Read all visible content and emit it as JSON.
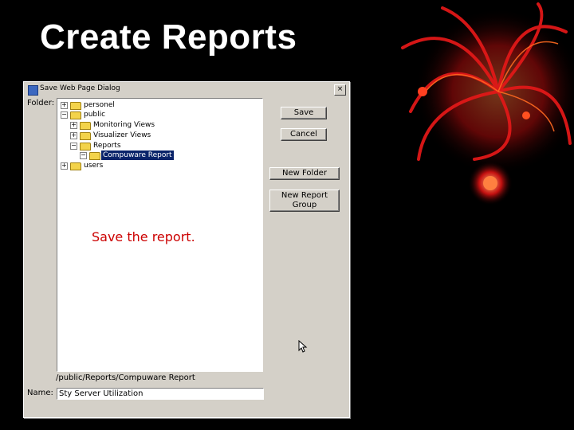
{
  "slide": {
    "title": "Create Reports"
  },
  "dialog": {
    "title": "Save    Web Page Dialog",
    "close_glyph": "×",
    "folder_label": "Folder:",
    "name_label": "Name:",
    "tree": [
      {
        "label": "personel",
        "expander": "+"
      },
      {
        "label": "public",
        "expander": "−"
      },
      {
        "label": "Monitoring Views",
        "expander": "+"
      },
      {
        "label": "Visualizer Views",
        "expander": "+"
      },
      {
        "label": "Reports",
        "expander": "−"
      },
      {
        "label": "Compuware Report",
        "expander": "−"
      },
      {
        "label": "users",
        "expander": "+"
      }
    ],
    "buttons": {
      "save": "Save",
      "cancel": "Cancel",
      "new_folder": "New Folder",
      "new_report_group": "New Report Group"
    },
    "path": "/public/Reports/Compuware Report",
    "name_value": "Sty Server Utilization"
  },
  "annotation": "Save the report.",
  "icons": [
    "folder-icon",
    "expander-icon",
    "mouse-cursor-icon",
    "dialog-app-icon",
    "close-icon"
  ],
  "colors": {
    "selection": "#0a246a",
    "caption": "#cc0000",
    "dialog_face": "#d4d0c8"
  }
}
